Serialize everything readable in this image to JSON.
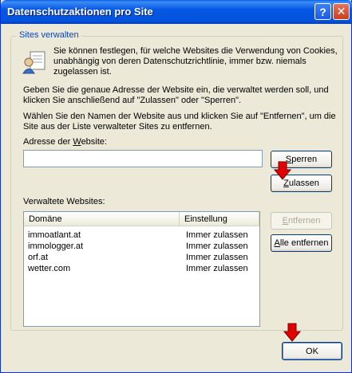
{
  "window": {
    "title": "Datenschutzaktionen pro Site",
    "help_button": "?",
    "close_button": "✕"
  },
  "group": {
    "legend": "Sites verwalten",
    "intro_line1": "Sie können festlegen, für welche Websites die Verwendung von Cookies,",
    "intro_line2": "unabhängig von deren Datenschutzrichtlinie, immer bzw. niemals",
    "intro_line3": "zugelassen ist.",
    "instr1_line1": "Geben Sie die genaue Adresse der Website ein, die verwaltet werden soll, und",
    "instr1_line2": "klicken Sie anschließend auf \"Zulassen\" oder \"Sperren\".",
    "instr2_line1": "Wählen Sie den Namen der Website aus und klicken Sie auf \"Entfernen\", um die",
    "instr2_line2": "Site aus der Liste verwalteter Sites zu entfernen."
  },
  "address": {
    "label_pre": "Adresse der ",
    "label_key": "W",
    "label_post": "ebsite:",
    "value": "",
    "placeholder": ""
  },
  "buttons": {
    "block_key": "S",
    "block_rest": "perren",
    "allow_key": "Z",
    "allow_rest": "ulassen",
    "remove_key": "E",
    "remove_rest": "ntfernen",
    "remove_all_key": "A",
    "remove_all_rest": "lle entfernen",
    "ok": "OK"
  },
  "managed": {
    "label": "Verwaltete Websites:",
    "columns": [
      "Domäne",
      "Einstellung"
    ],
    "rows": [
      {
        "domain": "immoatlant.at",
        "setting": "Immer zulassen"
      },
      {
        "domain": "immologger.at",
        "setting": "Immer zulassen"
      },
      {
        "domain": "orf.at",
        "setting": "Immer zulassen"
      },
      {
        "domain": "wetter.com",
        "setting": "Immer zulassen"
      }
    ]
  },
  "colors": {
    "titlebar": "#0558e4",
    "dialog_bg": "#ece9d8",
    "legend_text": "#0046d5",
    "annotation_arrow": "#e00000"
  },
  "icons": {
    "info": "privacy-info-icon",
    "arrow": "red-down-arrow-icon"
  }
}
